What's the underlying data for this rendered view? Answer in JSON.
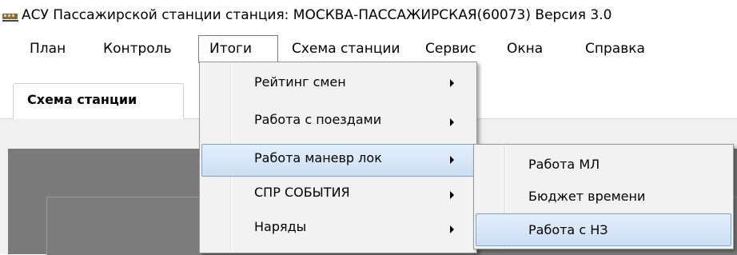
{
  "window": {
    "title": "АСУ Пассажирской станции станция: МОСКВА-ПАССАЖИРСКАЯ(60073)  Версия 3.0"
  },
  "menubar": {
    "items": [
      {
        "label": "План"
      },
      {
        "label": "Контроль"
      },
      {
        "label": "Итоги"
      },
      {
        "label": "Схема станции"
      },
      {
        "label": "Сервис"
      },
      {
        "label": "Окна"
      },
      {
        "label": "Справка"
      }
    ]
  },
  "tabs": [
    {
      "label": "Схема станции",
      "active": true
    }
  ],
  "itogi_menu": {
    "items": [
      {
        "label": "Рейтинг смен"
      },
      {
        "label": "Работа с поездами"
      },
      {
        "label": "Работа маневр лок",
        "highlighted": true
      },
      {
        "label": "СПР СОБЫТИЯ"
      },
      {
        "label": "Наряды"
      }
    ]
  },
  "submenu": {
    "items": [
      {
        "label": "Работа МЛ"
      },
      {
        "label": "Бюджет времени"
      },
      {
        "label": "Работа с НЗ",
        "highlighted": true
      }
    ]
  },
  "icons": {
    "app": "train-icon",
    "submenu_arrow": "triangle-right-icon"
  },
  "colors": {
    "highlight_border": "#7da2ce",
    "highlight_fill": "#cddff4",
    "menu_bg": "#f2f2f2",
    "workspace_dark": "#7a7a7a"
  }
}
